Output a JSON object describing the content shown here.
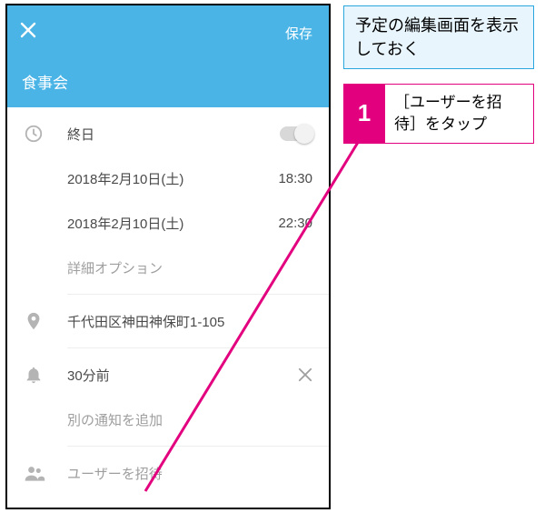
{
  "header": {
    "save_label": "保存",
    "title": "食事会"
  },
  "rows": {
    "allday_label": "終日",
    "start_date": "2018年2月10日(土)",
    "start_time": "18:30",
    "end_date": "2018年2月10日(土)",
    "end_time": "22:30",
    "more_options": "詳細オプション",
    "location": "千代田区神田神保町1-105",
    "reminder": "30分前",
    "add_reminder": "別の通知を追加",
    "invite": "ユーザーを招待"
  },
  "callouts": {
    "blue": "予定の編集画面を表示しておく",
    "step_num": "1",
    "step_text": "［ユーザーを招待］をタップ"
  }
}
